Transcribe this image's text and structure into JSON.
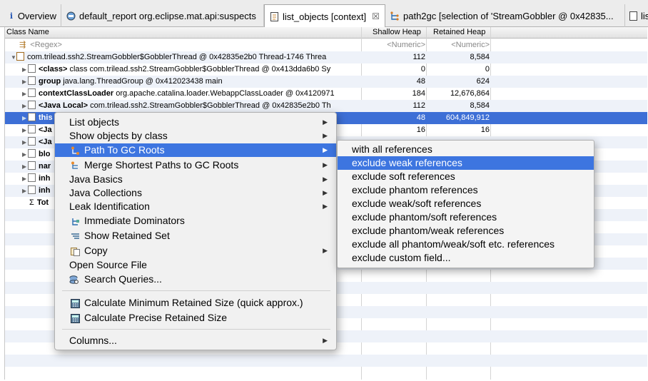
{
  "tabs": [
    {
      "icon": "info-icon",
      "label": "Overview"
    },
    {
      "icon": "report-icon",
      "label": "default_report  org.eclipse.mat.api:suspects"
    },
    {
      "icon": "page-icon",
      "label": "list_objects [context]"
    },
    {
      "icon": "tree-icon",
      "label": "path2gc [selection of 'StreamGobbler @ 0x42835..."
    },
    {
      "icon": "page-icon",
      "label": "lis"
    }
  ],
  "columns": {
    "name": "Class Name",
    "shallow": "Shallow Heap",
    "retained": "Retained Heap"
  },
  "filter": {
    "name": "<Regex>",
    "shallow": "<Numeric>",
    "retained": "<Numeric>"
  },
  "rows": [
    {
      "prefix": "",
      "bold": "",
      "text": "com.trilead.ssh2.StreamGobbler$GobblerThread @ 0x42835e2b0  Thread-1746 Threa",
      "shallow": "112",
      "retained": "8,584"
    },
    {
      "prefix": "",
      "bold": "<class>",
      "text": "class com.trilead.ssh2.StreamGobbler$GobblerThread @ 0x413dda6b0 Sy",
      "shallow": "0",
      "retained": "0"
    },
    {
      "prefix": "",
      "bold": "group",
      "text": "java.lang.ThreadGroup @ 0x412023438  main",
      "shallow": "48",
      "retained": "624"
    },
    {
      "prefix": "",
      "bold": "contextClassLoader",
      "text": "org.apache.catalina.loader.WebappClassLoader @ 0x4120971",
      "shallow": "184",
      "retained": "12,676,864"
    },
    {
      "prefix": "",
      "bold": "<Java Local>",
      "text": "com.trilead.ssh2.StreamGobbler$GobblerThread @ 0x42835e2b0  Th",
      "shallow": "112",
      "retained": "8,584"
    },
    {
      "prefix": "",
      "bold": "this",
      "text": "",
      "shallow": "48",
      "retained": "604,849,912"
    },
    {
      "prefix": "",
      "bold": "<Ja",
      "text": "",
      "shallow": "16",
      "retained": "16"
    },
    {
      "prefix": "",
      "bold": "<Ja",
      "text": "",
      "shallow": "",
      "retained": ""
    },
    {
      "prefix": "",
      "bold": "blo",
      "text": "",
      "shallow": "",
      "retained": ""
    },
    {
      "prefix": "",
      "bold": "nar",
      "text": "",
      "shallow": "",
      "retained": ""
    },
    {
      "prefix": "",
      "bold": "inh",
      "text": "",
      "shallow": "",
      "retained": ""
    },
    {
      "prefix": "",
      "bold": "inh",
      "text": "",
      "shallow": "",
      "retained": ""
    },
    {
      "prefix": "Σ",
      "bold": "Tot",
      "text": "",
      "shallow": "",
      "retained": ""
    }
  ],
  "context_menu": [
    {
      "label": "List objects",
      "submenu": true
    },
    {
      "label": "Show objects by class",
      "submenu": true
    },
    {
      "label": "Path To GC Roots",
      "submenu": true,
      "icon": "path-icon",
      "highlighted": true
    },
    {
      "label": "Merge Shortest Paths to GC Roots",
      "submenu": true,
      "icon": "merge-icon"
    },
    {
      "label": "Java Basics",
      "submenu": true
    },
    {
      "label": "Java Collections",
      "submenu": true
    },
    {
      "label": "Leak Identification",
      "submenu": true
    },
    {
      "label": "Immediate Dominators",
      "icon": "dominator-icon"
    },
    {
      "label": "Show Retained Set",
      "icon": "retained-set-icon"
    },
    {
      "label": "Copy",
      "submenu": true,
      "icon": "copy-icon"
    },
    {
      "label": "Open Source File"
    },
    {
      "label": "Search Queries...",
      "icon": "search-queries-icon"
    },
    {
      "label": "Calculate Minimum Retained Size (quick approx.)",
      "icon": "calculator-icon"
    },
    {
      "label": "Calculate Precise Retained Size",
      "icon": "calculator-icon"
    },
    {
      "label": "Columns...",
      "submenu": true
    }
  ],
  "submenu": [
    {
      "label": "with all references"
    },
    {
      "label": "exclude weak references",
      "highlighted": true
    },
    {
      "label": "exclude soft references"
    },
    {
      "label": "exclude phantom references"
    },
    {
      "label": "exclude weak/soft references"
    },
    {
      "label": "exclude phantom/soft references"
    },
    {
      "label": "exclude phantom/weak references"
    },
    {
      "label": "exclude all phantom/weak/soft etc. references"
    },
    {
      "label": "exclude custom field..."
    }
  ],
  "colors": {
    "selection": "#3d6fd6",
    "menu_highlight": "#3d75e0"
  }
}
